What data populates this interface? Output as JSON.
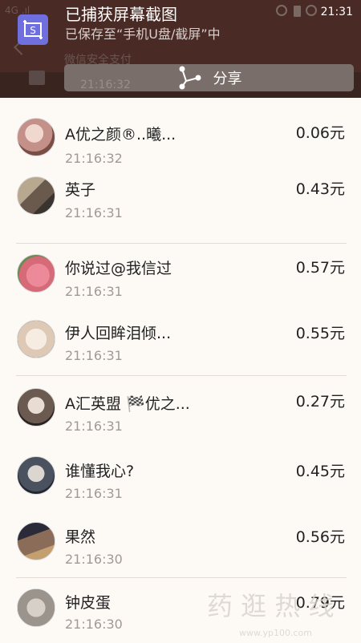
{
  "status_bar": {
    "signal": "4G .ıl",
    "time": "21:31",
    "right_time": "21:31"
  },
  "background": {
    "line1": "微信安全支付",
    "line2": "21:16:32"
  },
  "notification": {
    "title": "已捕获屏幕截图",
    "subtitle": "已保存至“手机U盘/截屏”中",
    "share_label": "分享",
    "icon": "screenshot-icon"
  },
  "list": {
    "items": [
      {
        "name": "A优之颜®..曦...",
        "time": "21:16:32",
        "amount": "0.06元",
        "avatar_color": "#c4908a"
      },
      {
        "name": "英子",
        "time": "21:16:31",
        "amount": "0.43元",
        "avatar_color": "#8a7a6a"
      },
      {
        "name": "你说过@我信过",
        "time": "21:16:31",
        "amount": "0.57元",
        "avatar_color": "#d66a78"
      },
      {
        "name": "伊人回眸泪倾...",
        "time": "21:16:31",
        "amount": "0.55元",
        "avatar_color": "#dec8b6"
      },
      {
        "name": "A汇英盟 🏁优之...",
        "time": "21:16:31",
        "amount": "0.27元",
        "avatar_color": "#6a5a50"
      },
      {
        "name": "谁懂我心?",
        "time": "21:16:31",
        "amount": "0.45元",
        "avatar_color": "#4a5260"
      },
      {
        "name": "果然",
        "time": "21:16:30",
        "amount": "0.56元",
        "avatar_color": "#8a6c58"
      },
      {
        "name": "钟皮蛋",
        "time": "21:16:30",
        "amount": "0.79元",
        "avatar_color": "#9a948c"
      }
    ]
  },
  "watermark": {
    "text": "药 逛 热 线",
    "sub": "www.yp100.com"
  },
  "colors": {
    "background": "#fdfaf6",
    "notification_bg": "#4a2a24",
    "share_button": "#7a6e6b",
    "icon_accent": "#6f6fe0",
    "text_primary": "#222222",
    "text_secondary": "#a19a94"
  }
}
